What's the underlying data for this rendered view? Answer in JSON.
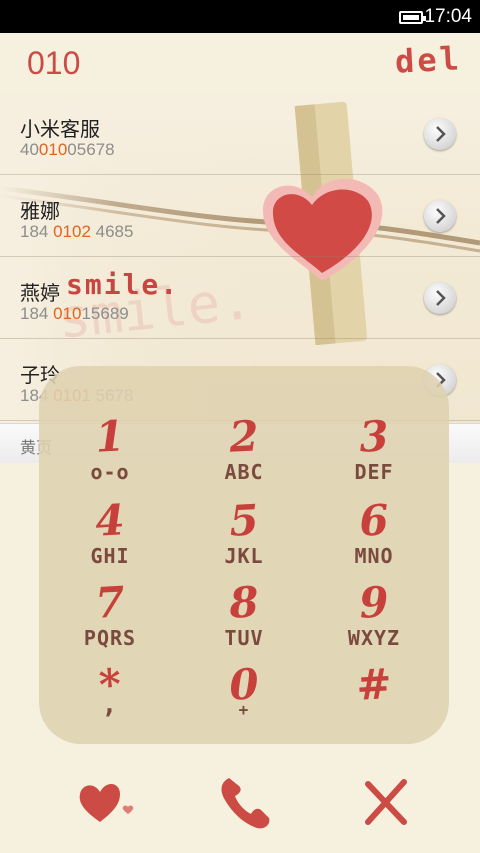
{
  "status_bar": {
    "time": "17:04"
  },
  "header": {
    "dial_number": "010",
    "del_label": "del"
  },
  "art": {
    "smile_text": "smile."
  },
  "contacts": [
    {
      "name": "小米客服",
      "num_pre": "40",
      "num_hl": "010",
      "num_post": "05678"
    },
    {
      "name": "雅娜",
      "num_pre": "184 ",
      "num_hl": "0102",
      "num_post": " 4685"
    },
    {
      "name": "燕婷",
      "num_pre": "184 ",
      "num_hl": "010",
      "num_post": "15689"
    },
    {
      "name": "子玲",
      "num_pre": "184 ",
      "num_hl": "0101",
      "num_post": " 5678"
    }
  ],
  "section": {
    "label": "黄页"
  },
  "dialpad": {
    "keys": [
      {
        "digit": "1",
        "letters": "o-o"
      },
      {
        "digit": "2",
        "letters": "ABC"
      },
      {
        "digit": "3",
        "letters": "DEF"
      },
      {
        "digit": "4",
        "letters": "GHI"
      },
      {
        "digit": "5",
        "letters": "JKL"
      },
      {
        "digit": "6",
        "letters": "MNO"
      },
      {
        "digit": "7",
        "letters": "PQRS"
      },
      {
        "digit": "8",
        "letters": "TUV"
      },
      {
        "digit": "9",
        "letters": "WXYZ"
      },
      {
        "digit": "*",
        "letters": ","
      },
      {
        "digit": "0",
        "letters": "+"
      },
      {
        "digit": "#",
        "letters": ""
      }
    ]
  },
  "actions": {
    "favorites_icon": "heart-icon",
    "call_icon": "phone-icon",
    "close_icon": "close-icon"
  },
  "colors": {
    "accent": "#cc4b44",
    "highlight": "#e4631e",
    "background": "#f6f1df",
    "dialpad": "#ded1af"
  }
}
